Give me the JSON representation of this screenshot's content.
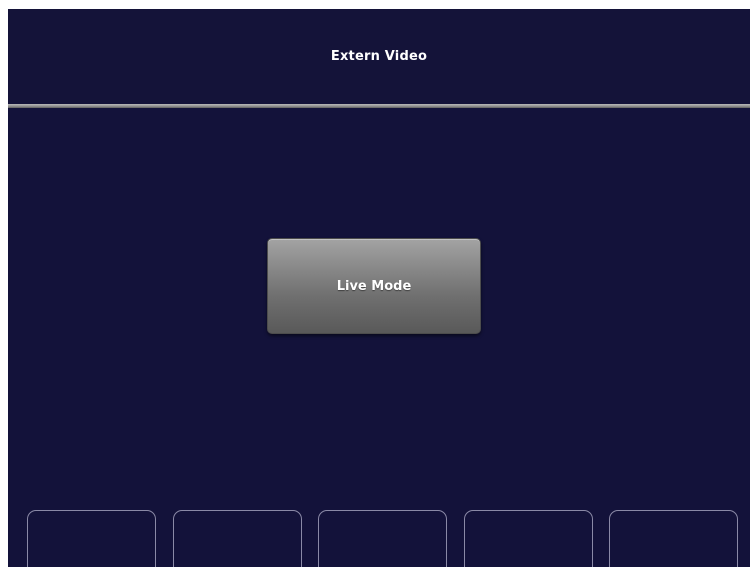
{
  "header": {
    "title": "Extern Video"
  },
  "main": {
    "live_mode_label": "Live Mode"
  },
  "softkeys": [
    {
      "label": ""
    },
    {
      "label": ""
    },
    {
      "label": ""
    },
    {
      "label": ""
    },
    {
      "label": ""
    }
  ],
  "colors": {
    "background": "#13123a",
    "divider": "#a9a9a9",
    "button": "#7a7a7a",
    "softkey_border": "#8a89a6",
    "text": "#ffffff"
  }
}
